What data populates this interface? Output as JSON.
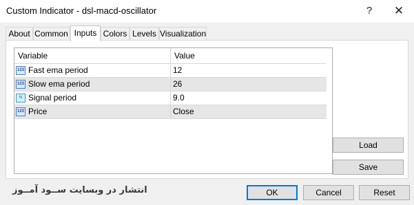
{
  "window": {
    "title": "Custom Indicator - dsl-macd-oscillator",
    "help_label": "?",
    "close_label": "✕"
  },
  "tabs": [
    {
      "label": "About",
      "active": false
    },
    {
      "label": "Common",
      "active": false
    },
    {
      "label": "Inputs",
      "active": true
    },
    {
      "label": "Colors",
      "active": false
    },
    {
      "label": "Levels",
      "active": false
    },
    {
      "label": "Visualization",
      "active": false
    }
  ],
  "inputs_table": {
    "columns": [
      "Variable",
      "Value"
    ],
    "rows": [
      {
        "icon": "123",
        "icon_name": "integer-param-icon",
        "name": "Fast ema period",
        "value": "12"
      },
      {
        "icon": "123",
        "icon_name": "integer-param-icon",
        "name": "Slow ema period",
        "value": "26"
      },
      {
        "icon": "½",
        "icon_name": "double-param-icon",
        "name": "Signal period",
        "value": "9.0"
      },
      {
        "icon": "123",
        "icon_name": "enum-param-icon",
        "name": "Price",
        "value": "Close"
      }
    ]
  },
  "side_buttons": {
    "load": "Load",
    "save": "Save"
  },
  "footer": {
    "watermark": "انتشار در وبسایت ســود آمــوز",
    "ok": "OK",
    "cancel": "Cancel",
    "reset": "Reset"
  }
}
